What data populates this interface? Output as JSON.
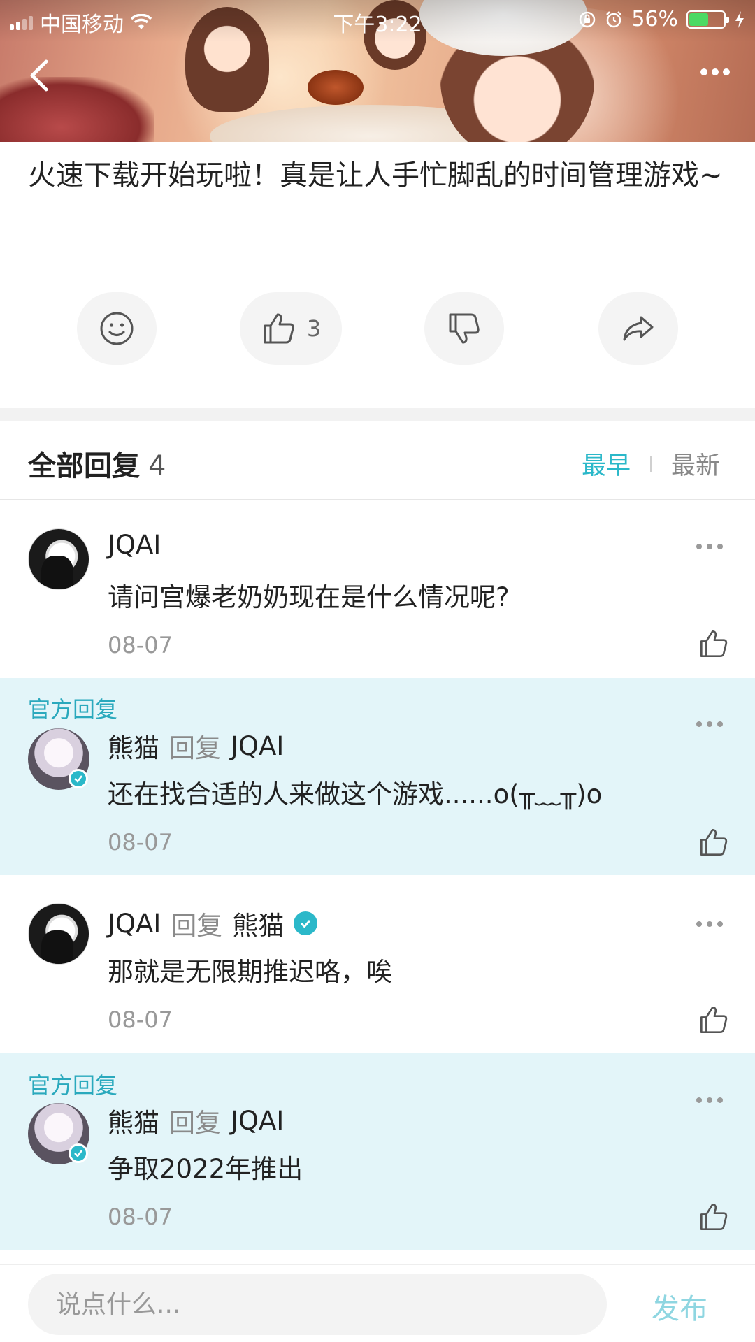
{
  "status_bar": {
    "carrier": "中国移动",
    "time": "下午3:22",
    "battery": "56%"
  },
  "post": {
    "text": "火速下载开始玩啦！真是让人手忙脚乱的时间管理游戏~",
    "like_count": "3"
  },
  "replies": {
    "title": "全部回复",
    "count": "4",
    "sort_earliest": "最早",
    "sort_latest": "最新"
  },
  "comments": [
    {
      "official": false,
      "author": "JQAI",
      "reply_word": "",
      "reply_to": "",
      "text": "请问宫爆老奶奶现在是什么情况呢?",
      "date": "08-07"
    },
    {
      "official": true,
      "official_label": "官方回复",
      "author": "熊猫",
      "reply_word": "回复",
      "reply_to": "JQAI",
      "text": "还在找合适的人来做这个游戏......o(╥﹏╥)o",
      "date": "08-07"
    },
    {
      "official": false,
      "author": "JQAI",
      "reply_word": "回复",
      "reply_to": "熊猫",
      "text": "那就是无限期推迟咯，唉",
      "date": "08-07"
    },
    {
      "official": true,
      "official_label": "官方回复",
      "author": "熊猫",
      "reply_word": "回复",
      "reply_to": "JQAI",
      "text": "争取2022年推出",
      "date": "08-07"
    }
  ],
  "input": {
    "placeholder": "说点什么...",
    "publish_label": "发布"
  },
  "icons": {
    "back": "chevron-left-icon",
    "more": "more-horizontal-icon",
    "emoji": "smiley-icon",
    "like": "thumbs-up-icon",
    "dislike": "thumbs-down-icon",
    "share": "share-icon",
    "verified": "verified-check-icon"
  },
  "colors": {
    "accent": "#2bb8c9",
    "official_bg": "#e3f5f9",
    "publish_disabled": "#8fd6e1"
  }
}
